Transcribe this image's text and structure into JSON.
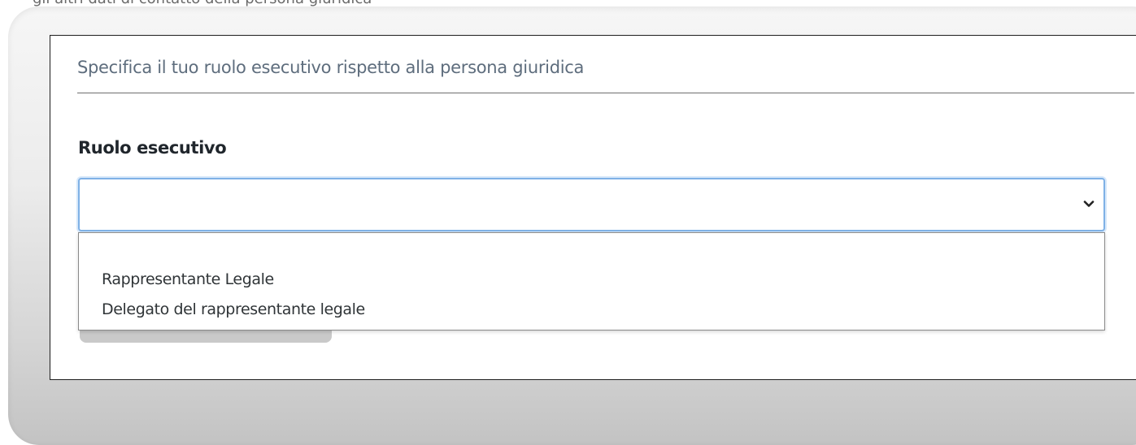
{
  "top_clipped_text": "gli altri dati di contatto della persona giuridica",
  "section": {
    "heading": "Specifica il tuo ruolo esecutivo rispetto alla persona giuridica"
  },
  "field": {
    "label": "Ruolo esecutivo",
    "selected_value": "",
    "chevron_icon": "chevron-down-icon"
  },
  "dropdown": {
    "options": [
      {
        "label": ""
      },
      {
        "label": "Rappresentante Legale"
      },
      {
        "label": "Delegato del rappresentante legale"
      }
    ]
  },
  "colors": {
    "focus_border": "#7fb1e6",
    "heading_text": "#5e6d7d",
    "label_text": "#20262c"
  }
}
